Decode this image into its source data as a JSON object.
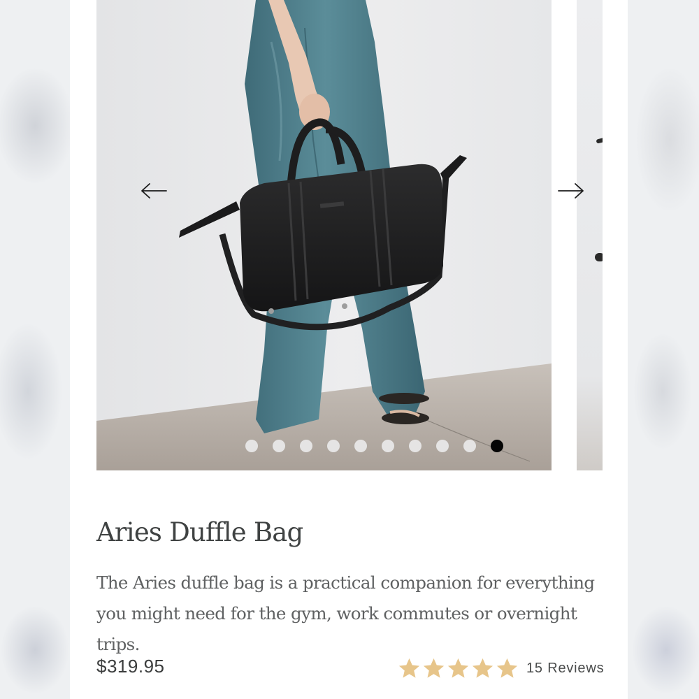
{
  "product": {
    "title": "Aries Duffle Bag",
    "description": "The Aries duffle bag is a practical companion for everything you might need for the gym, work commutes or overnight trips.",
    "price": "$319.95",
    "rating": {
      "stars_filled": 5,
      "stars_total": 5,
      "reviews_label": "15 Reviews",
      "star_color": "#e7c58a"
    }
  },
  "gallery": {
    "image_description": "model holding a black leather duffle bag",
    "prev_icon": "arrow-left-icon",
    "next_icon": "arrow-right-icon",
    "slide_count": 10,
    "active_slide": 10
  },
  "colors": {
    "text_primary": "#3f4242",
    "text_secondary": "#5f6162",
    "dot_inactive": "#eeeef0",
    "dot_active": "#050505"
  }
}
